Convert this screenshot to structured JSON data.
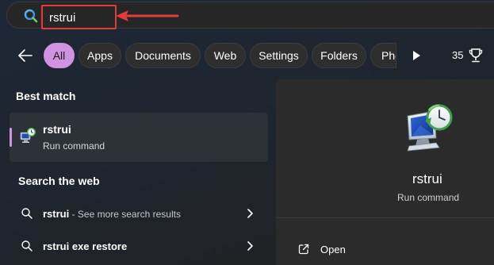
{
  "search": {
    "value": "rstrui"
  },
  "filters": [
    {
      "label": "All",
      "active": true
    },
    {
      "label": "Apps",
      "active": false
    },
    {
      "label": "Documents",
      "active": false
    },
    {
      "label": "Web",
      "active": false
    },
    {
      "label": "Settings",
      "active": false
    },
    {
      "label": "Folders",
      "active": false
    },
    {
      "label": "Pho",
      "active": false
    }
  ],
  "rewards": {
    "points": "35",
    "icon": "trophy-icon"
  },
  "best_match": {
    "heading": "Best match",
    "name": "rstrui",
    "type": "Run command",
    "icon": "system-restore-icon"
  },
  "web": {
    "heading": "Search the web",
    "items": [
      {
        "query": "rstrui",
        "suffix": " - See more search results"
      },
      {
        "query": "rstrui exe restore",
        "suffix": ""
      }
    ]
  },
  "preview": {
    "name": "rstrui",
    "type": "Run command",
    "actions": [
      {
        "label": "Open",
        "icon": "open-external-icon"
      }
    ]
  },
  "colors": {
    "accent": "#cf93e2",
    "annotation": "#e23c3c"
  }
}
